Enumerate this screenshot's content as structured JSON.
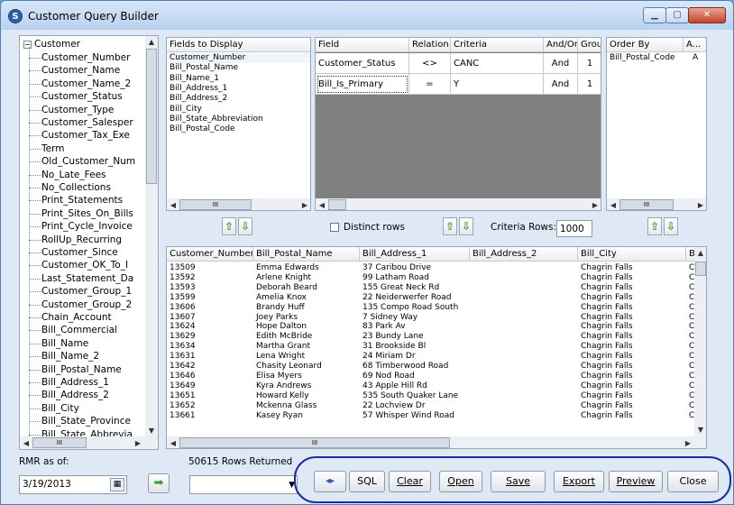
{
  "window": {
    "title": "Customer Query Builder",
    "icon_letter": "S"
  },
  "tree": {
    "root": "Customer",
    "items": [
      "Customer_Number",
      "Customer_Name",
      "Customer_Name_2",
      "Customer_Status",
      "Customer_Type",
      "Customer_Salesper",
      "Customer_Tax_Exe",
      "Term",
      "Old_Customer_Num",
      "No_Late_Fees",
      "No_Collections",
      "Print_Statements",
      "Print_Sites_On_Bills",
      "Print_Cycle_Invoice",
      "RollUp_Recurring",
      "Customer_Since",
      "Customer_OK_To_I",
      "Last_Statement_Da",
      "Customer_Group_1",
      "Customer_Group_2",
      "Chain_Account",
      "Bill_Commercial",
      "Bill_Name",
      "Bill_Name_2",
      "Bill_Postal_Name",
      "Bill_Address_1",
      "Bill_Address_2",
      "Bill_City",
      "Bill_State_Province",
      "Bill_State_Abbrevia"
    ],
    "hscroll_glyph": "III"
  },
  "fields_display": {
    "header": "Fields to Display",
    "items": [
      "Customer_Number",
      "Bill_Postal_Name",
      "Bill_Name_1",
      "Bill_Address_1",
      "Bill_Address_2",
      "Bill_City",
      "Bill_State_Abbreviation",
      "Bill_Postal_Code"
    ],
    "scroll_glyph": "III"
  },
  "criteria": {
    "headers": [
      "Field",
      "Relation",
      "Criteria",
      "And/Or",
      "Group"
    ],
    "rows": [
      {
        "field": "Customer_Status",
        "relation": "<>",
        "criteria": "CANC",
        "andor": "And",
        "group": "1"
      },
      {
        "field": "Bill_Is_Primary",
        "relation": "=",
        "criteria": "Y",
        "andor": "And",
        "group": "1"
      }
    ],
    "distinct_label": "Distinct rows",
    "criteria_rows_label": "Criteria Rows:",
    "criteria_rows_value": "1000"
  },
  "order_by": {
    "headers": [
      "Order By",
      "A..."
    ],
    "rows": [
      {
        "field": "Bill_Postal_Code",
        "dir": "A"
      }
    ],
    "scroll_glyph": "III"
  },
  "results": {
    "headers": [
      "Customer_Number",
      "Bill_Postal_Name",
      "Bill_Address_1",
      "Bill_Address_2",
      "Bill_City",
      "B"
    ],
    "rows": [
      [
        "13509",
        "Emma Edwards",
        "37 Caribou Drive",
        "",
        "Chagrin Falls",
        "C"
      ],
      [
        "13592",
        "Arlene Knight",
        "99 Latham Road",
        "",
        "Chagrin Falls",
        "C"
      ],
      [
        "13593",
        "Deborah Beard",
        "155 Great Neck Rd",
        "",
        "Chagrin Falls",
        "C"
      ],
      [
        "13599",
        "Amelia Knox",
        "22 Neiderwerfer Road",
        "",
        "Chagrin Falls",
        "C"
      ],
      [
        "13606",
        "Brandy Huff",
        "135 Compo Road South",
        "",
        "Chagrin Falls",
        "C"
      ],
      [
        "13607",
        "Joey Parks",
        "7 Sidney Way",
        "",
        "Chagrin Falls",
        "C"
      ],
      [
        "13624",
        "Hope Dalton",
        "83 Park Av",
        "",
        "Chagrin Falls",
        "C"
      ],
      [
        "13629",
        "Edith McBride",
        "23 Bundy Lane",
        "",
        "Chagrin Falls",
        "C"
      ],
      [
        "13634",
        "Martha Grant",
        "31 Brookside Bl",
        "",
        "Chagrin Falls",
        "C"
      ],
      [
        "13631",
        "Lena Wright",
        "24 Miriam Dr",
        "",
        "Chagrin Falls",
        "C"
      ],
      [
        "13642",
        "Chasity Leonard",
        "68 Timberwood Road",
        "",
        "Chagrin Falls",
        "C"
      ],
      [
        "13646",
        "Elisa Myers",
        "69 Nod Road",
        "",
        "Chagrin Falls",
        "C"
      ],
      [
        "13649",
        "Kyra Andrews",
        "43 Apple Hill Rd",
        "",
        "Chagrin Falls",
        "C"
      ],
      [
        "13651",
        "Howard Kelly",
        "535 South Quaker Lane",
        "",
        "Chagrin Falls",
        "C"
      ],
      [
        "13652",
        "Mckenna Glass",
        "22 Lochview Dr",
        "",
        "Chagrin Falls",
        "C"
      ],
      [
        "13661",
        "Kasey Ryan",
        "57 Whisper Wind Road",
        "",
        "Chagrin Falls",
        "C"
      ]
    ],
    "scroll_glyph": "III"
  },
  "status": {
    "rmr_label": "RMR as of:",
    "rows_returned": "50615 Rows Returned",
    "date_value": "3/19/2013",
    "go_glyph": "➡"
  },
  "buttons": {
    "swap": "◂▸",
    "sql": "SQL",
    "clear": "Clear",
    "open": "Open",
    "save": "Save",
    "export": "Export",
    "preview": "Preview",
    "close": "Close"
  },
  "colors": {
    "accent": "#1b2d9c",
    "grid": "#808080"
  }
}
